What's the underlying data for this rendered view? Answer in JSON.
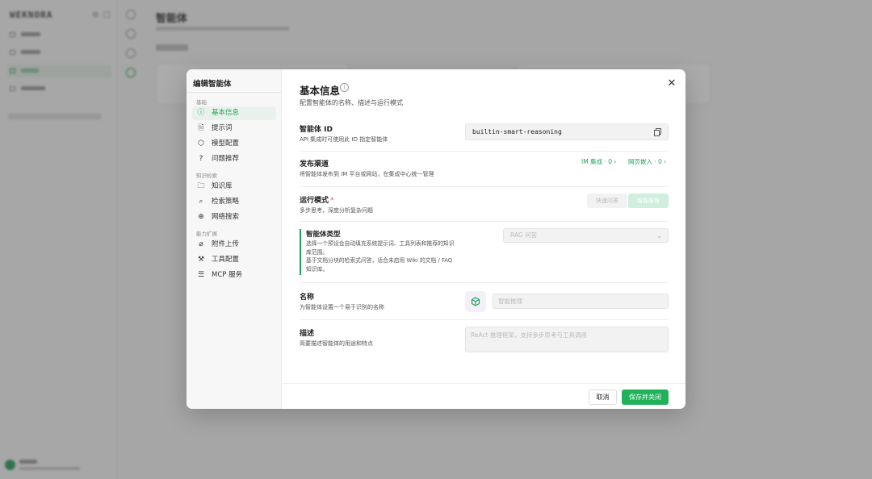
{
  "background": {
    "logo": "WEKNORA",
    "page_title": "智能体",
    "sidebar_items": [
      "",
      "",
      "",
      ""
    ],
    "accent": "#21a35a"
  },
  "modal": {
    "title": "编辑智能体",
    "nav_groups": [
      {
        "label": "基础",
        "items": [
          {
            "label": "基本信息",
            "icon": "info-circle-icon",
            "active": true
          },
          {
            "label": "提示词",
            "icon": "document-icon"
          },
          {
            "label": "模型配置",
            "icon": "cube-icon"
          },
          {
            "label": "问题推荐",
            "icon": "question-circle-icon"
          }
        ]
      },
      {
        "label": "知识检索",
        "items": [
          {
            "label": "知识库",
            "icon": "folder-icon"
          },
          {
            "label": "检索策略",
            "icon": "search-icon"
          },
          {
            "label": "网络搜索",
            "icon": "globe-icon"
          }
        ]
      },
      {
        "label": "能力扩展",
        "items": [
          {
            "label": "附件上传",
            "icon": "paperclip-icon"
          },
          {
            "label": "工具配置",
            "icon": "wrench-icon"
          },
          {
            "label": "MCP 服务",
            "icon": "server-icon"
          }
        ]
      }
    ],
    "section": {
      "title": "基本信息",
      "subtitle": "配置智能体的名称、描述与运行模式"
    },
    "agent_id": {
      "label": "智能体 ID",
      "desc": "API 集成时可使用此 ID 指定智能体",
      "value": "builtin-smart-reasoning"
    },
    "channels": {
      "label": "发布渠道",
      "desc": "将智能体发布到 IM 平台或网站，在集成中心统一管理",
      "im_link": "IM 集成 · 0 ›",
      "web_link": "网页嵌入 · 0 ›"
    },
    "run_mode": {
      "label": "运行模式",
      "required_mark": "*",
      "desc": "多步思考，深度分析复杂问题",
      "option_off": "快速问答",
      "option_on": "智能推理"
    },
    "agent_type": {
      "label": "智能体类型",
      "desc_line1": "选择一个预设会自动填充系统提示词、工具列表和推荐的知识库范围。",
      "desc_line2": "基于文档分块的检索式问答，适合未启用 Wiki 的文档 / FAQ 知识库。",
      "selected": "RAG 问答"
    },
    "name": {
      "label": "名称",
      "desc": "为智能体设置一个易于识别的名称",
      "placeholder": "智能推理"
    },
    "description": {
      "label": "描述",
      "desc": "简要描述智能体的用途和特点",
      "placeholder": "ReAct 推理框架，支持多步思考与工具调用"
    },
    "footer": {
      "cancel": "取消",
      "save": "保存并关闭"
    }
  }
}
